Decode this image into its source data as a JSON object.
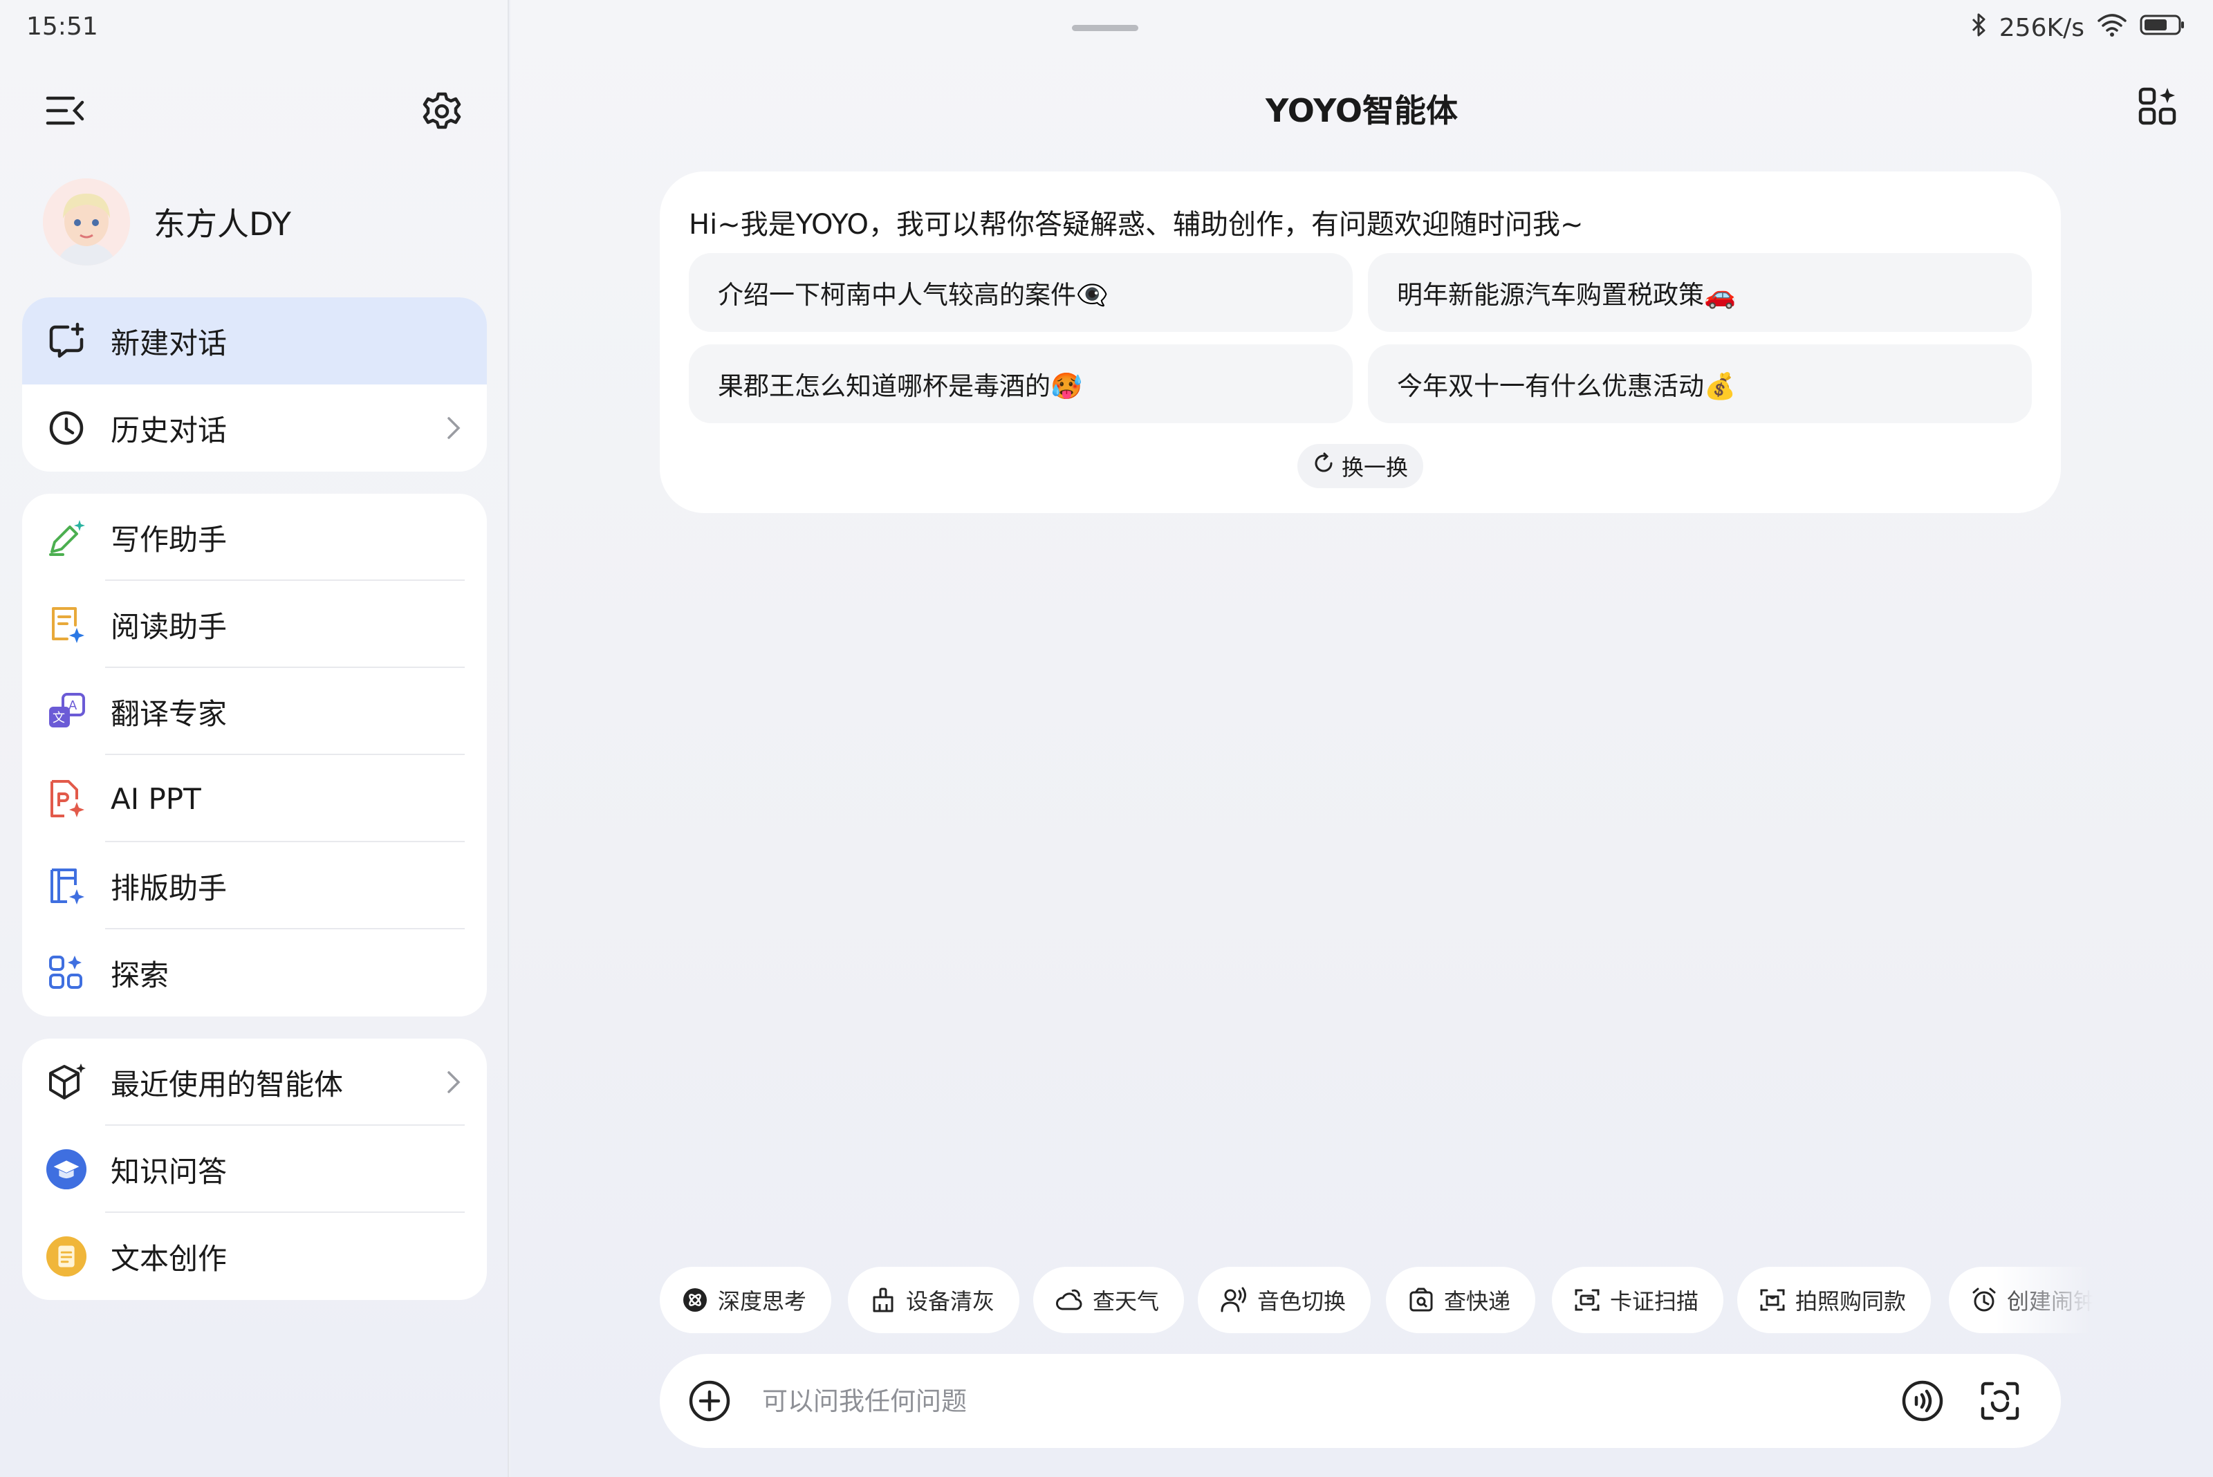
{
  "status_bar": {
    "time": "15:51",
    "net_speed": "256K/s",
    "icons": [
      "bluetooth-icon",
      "wifi-icon",
      "battery-icon"
    ]
  },
  "sidebar": {
    "icons": {
      "collapse": "menu-collapse-icon",
      "settings": "gear-icon"
    },
    "user": {
      "name": "东方人DY"
    },
    "top_items": [
      {
        "label": "新建对话",
        "icon": "new-chat-icon",
        "active": true
      },
      {
        "label": "历史对话",
        "icon": "clock-icon",
        "chevron": true
      }
    ],
    "assistant_items": [
      {
        "label": "写作助手",
        "icon": "pen-sparkle-icon",
        "color": "#4caf50"
      },
      {
        "label": "阅读助手",
        "icon": "document-sparkle-icon",
        "color": "#e8a93a"
      },
      {
        "label": "翻译专家",
        "icon": "translate-icon",
        "color": "#6b5bd6"
      },
      {
        "label": "AI PPT",
        "icon": "ppt-file-icon",
        "color": "#e25a4a"
      },
      {
        "label": "排版助手",
        "icon": "layout-icon",
        "color": "#3f6fe0"
      },
      {
        "label": "探索",
        "icon": "grid-sparkle-icon",
        "color": "#3f6fe0"
      }
    ],
    "agent_items": [
      {
        "label": "最近使用的智能体",
        "icon": "cube-icon",
        "chevron": true
      },
      {
        "label": "知识问答",
        "icon": "graduation-cap-icon",
        "color": "#3f6fe0"
      },
      {
        "label": "文本创作",
        "icon": "text-note-icon",
        "color": "#f0b63a"
      }
    ]
  },
  "main": {
    "title": "YOYO智能体",
    "top_right_icon": "apps-sparkle-icon",
    "welcome": "Hi~我是YOYO，我可以帮你答疑解惑、辅助创作，有问题欢迎随时问我~",
    "suggestions": [
      "介绍一下柯南中人气较高的案件👁️‍🗨️",
      "明年新能源汽车购置税政策🚗",
      "果郡王怎么知道哪杯是毒酒的🥵",
      "今年双十一有什么优惠活动💰"
    ],
    "refresh_label": "换一换",
    "chips": [
      {
        "label": "深度思考",
        "icon": "deep-think-icon"
      },
      {
        "label": "设备清灰",
        "icon": "broom-icon"
      },
      {
        "label": "查天气",
        "icon": "weather-cloud-icon"
      },
      {
        "label": "音色切换",
        "icon": "voice-person-icon"
      },
      {
        "label": "查快递",
        "icon": "package-icon"
      },
      {
        "label": "卡证扫描",
        "icon": "card-scan-icon"
      },
      {
        "label": "拍照购同款",
        "icon": "photo-shop-icon"
      },
      {
        "label": "创建闹钟",
        "icon": "alarm-icon"
      }
    ],
    "input": {
      "placeholder": "可以问我任何问题",
      "value": ""
    },
    "input_icons": {
      "add": "plus-circle-icon",
      "voice": "voice-wave-icon",
      "scan": "scan-icon"
    }
  }
}
